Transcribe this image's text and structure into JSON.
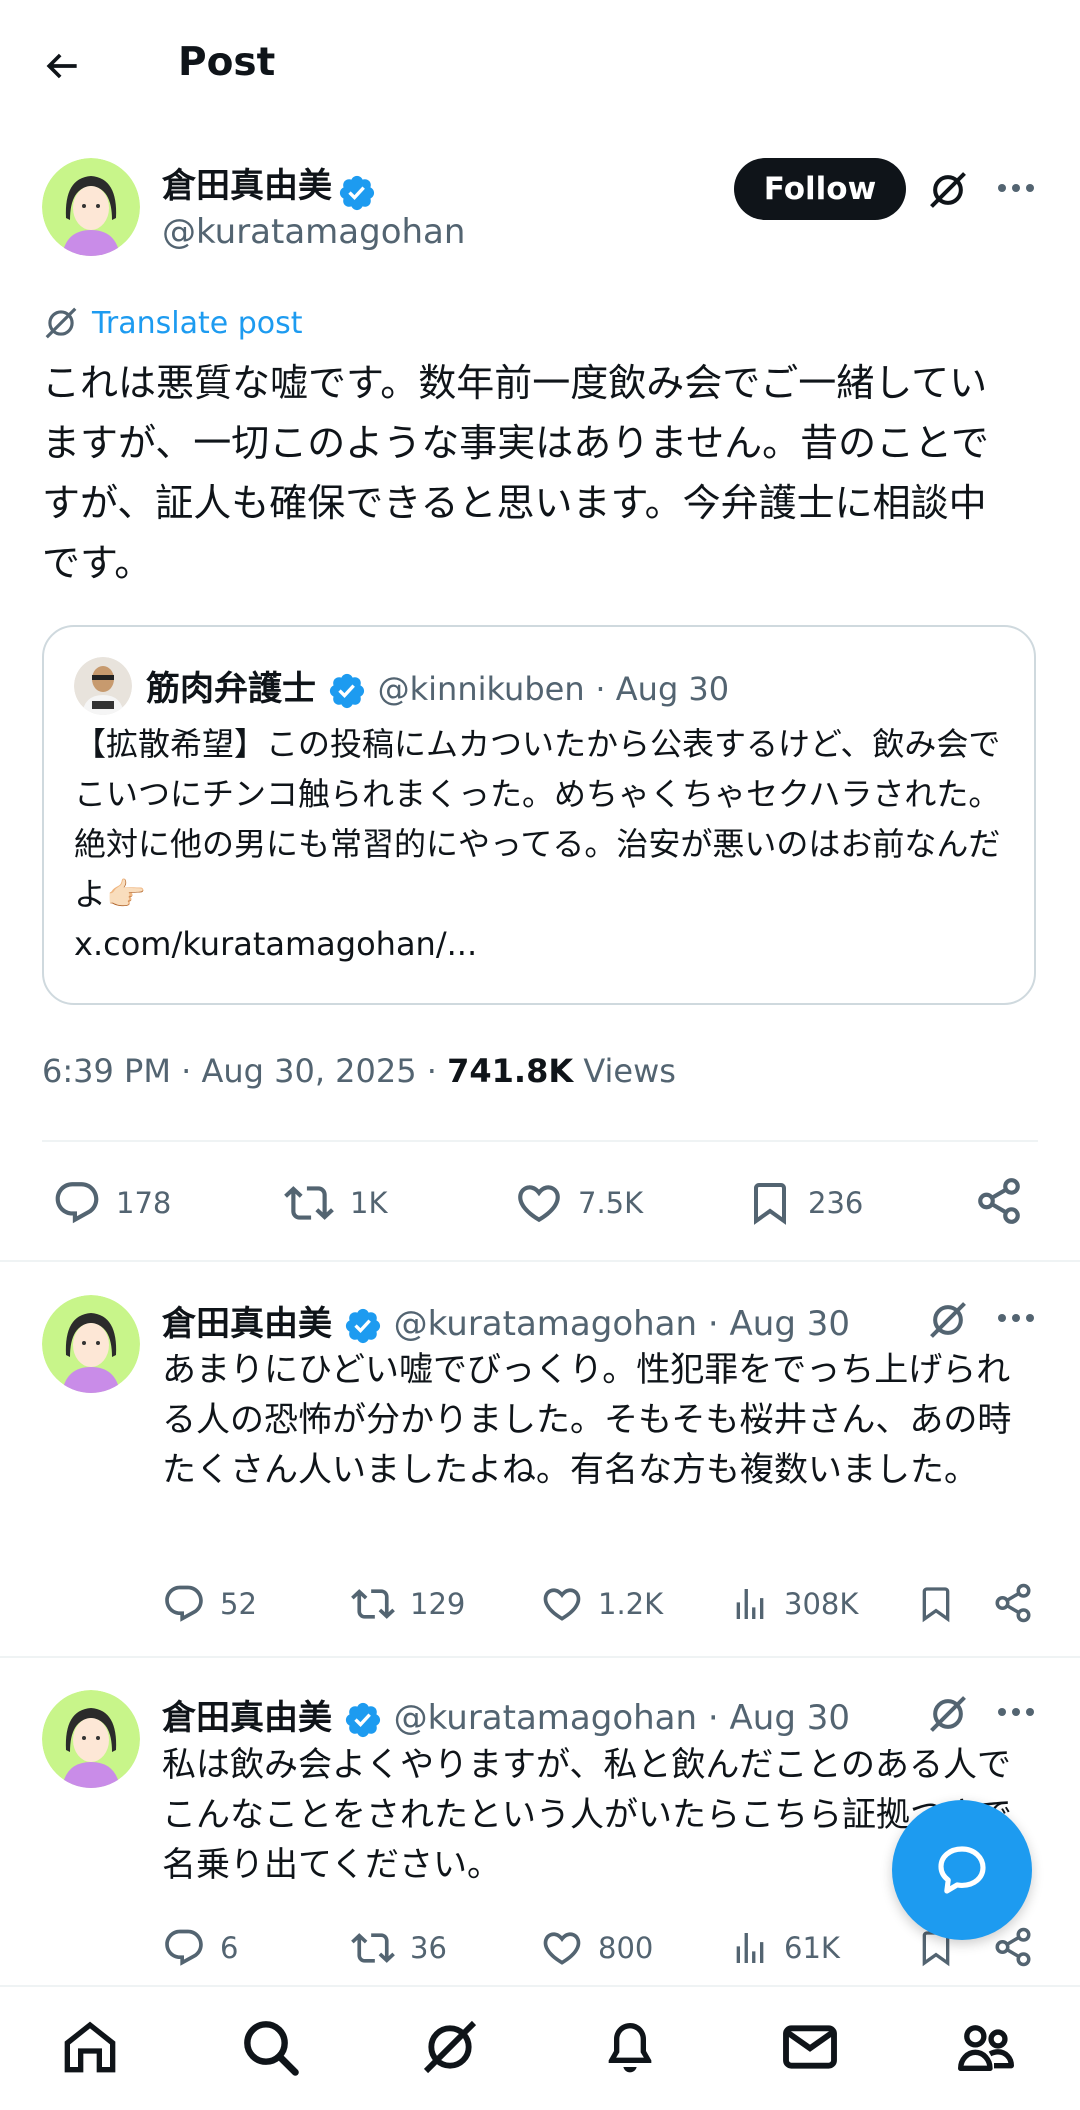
{
  "header": {
    "title": "Post"
  },
  "colors": {
    "accent": "#1d9bf0",
    "text": "#0f1419",
    "muted": "#536471"
  },
  "main_post": {
    "author_name": "倉田真由美",
    "author_handle": "@kuratamagohan",
    "follow_label": "Follow",
    "translate_label": "Translate post",
    "text": "これは悪質な嘘です。数年前一度飲み会でご一緒していますが、一切このような事実はありません。昔のことですが、証人も確保できると思います。今弁護士に相談中です。",
    "quote": {
      "author_name": "筋肉弁護士",
      "author_handle": "@kinnikuben",
      "date": "· Aug 30",
      "text": "【拡散希望】この投稿にムカついたから公表するけど、飲み会でこいつにチンコ触られまくった。めちゃくちゃセクハラされた。絶対に他の男にも常習的にやってる。治安が悪いのはお前なんだよ",
      "emoji": "👉🏻",
      "link": "x.com/kuratamagohan/..."
    },
    "timestamp": "6:39 PM · Aug 30, 2025 ·",
    "views_count": "741.8K",
    "views_label": "Views",
    "stats": {
      "replies": "178",
      "reposts": "1K",
      "likes": "7.5K",
      "bookmarks": "236"
    }
  },
  "replies": [
    {
      "author_name": "倉田真由美",
      "author_handle": "@kuratamagohan",
      "date": "· Aug 30",
      "text": "あまりにひどい嘘でびっくり。性犯罪をでっち上げられる人の恐怖が分かりました。そもそも桜井さん、あの時たくさん人いましたよね。有名な方も複数いました。",
      "stats": {
        "replies": "52",
        "reposts": "129",
        "likes": "1.2K",
        "views": "308K"
      }
    },
    {
      "author_name": "倉田真由美",
      "author_handle": "@kuratamagohan",
      "date": "· Aug 30",
      "text": "私は飲み会よくやりますが、私と飲んだことのある人でこんなことをされたという人がいたらこちら証拠つきで名乗り出てください。",
      "stats": {
        "replies": "6",
        "reposts": "36",
        "likes": "800",
        "views": "61K"
      }
    }
  ],
  "icons": [
    "back-arrow-icon",
    "verified-icon",
    "grok-icon",
    "more-icon",
    "reply-icon",
    "repost-icon",
    "like-icon",
    "bookmark-icon",
    "share-icon",
    "views-icon",
    "chat-icon",
    "home-icon",
    "search-icon",
    "notifications-icon",
    "messages-icon",
    "communities-icon"
  ]
}
